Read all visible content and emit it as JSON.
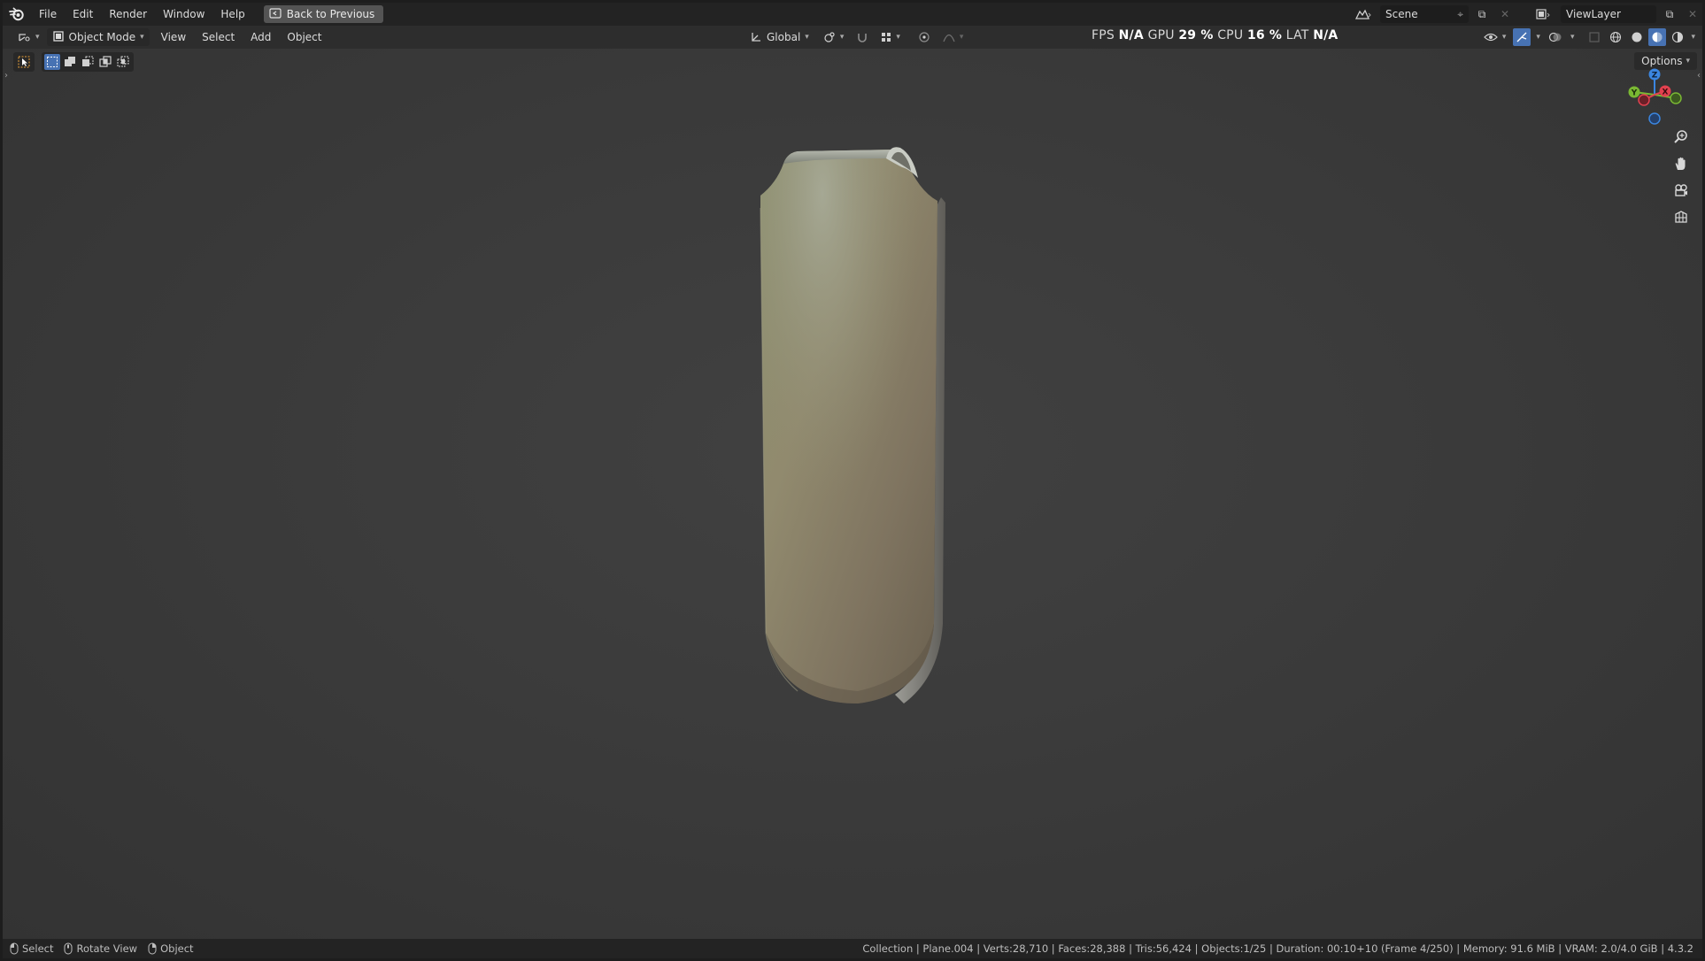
{
  "menubar": {
    "items": [
      "File",
      "Edit",
      "Render",
      "Window",
      "Help"
    ],
    "back_label": "Back to Previous"
  },
  "scene": {
    "name": "Scene",
    "view_layer": "ViewLayer"
  },
  "header": {
    "mode": "Object Mode",
    "menus": [
      "View",
      "Select",
      "Add",
      "Object"
    ],
    "transform_orientation": "Global",
    "options_label": "Options"
  },
  "stats": {
    "fps_label": "FPS",
    "fps_value": "N/A",
    "gpu_label": "GPU",
    "gpu_value": "29 %",
    "cpu_label": "CPU",
    "cpu_value": "16 %",
    "lat_label": "LAT",
    "lat_value": "N/A"
  },
  "gizmo": {
    "z": "Z",
    "y": "Y",
    "x": "X"
  },
  "statusbar": {
    "select": "Select",
    "rotate": "Rotate View",
    "object": "Object",
    "info": "Collection | Plane.004 | Verts:28,710 | Faces:28,388 | Tris:56,424 | Objects:1/25 | Duration: 00:10+10 (Frame 4/250) | Memory: 91.6 MiB | VRAM: 2.0/4.0 GiB | 4.3.2"
  },
  "colors": {
    "accent": "#4772b3",
    "axis_x": "#e2414f",
    "axis_y": "#7ab833",
    "axis_z": "#3b86e0"
  },
  "icons": {
    "app": "blender-logo-icon",
    "back": "back-icon",
    "scene": "scene-icon",
    "view_layer": "view-layer-icon",
    "zoom": "zoom-icon",
    "pan": "hand-icon",
    "camera": "camera-icon",
    "ortho": "grid-icon"
  }
}
